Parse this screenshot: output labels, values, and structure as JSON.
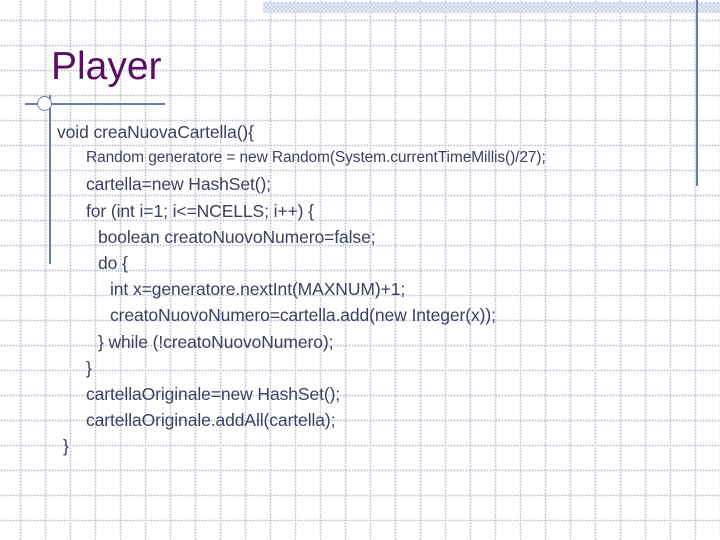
{
  "slide": {
    "title": "Player",
    "code": {
      "lines": [
        {
          "text": "void creaNuovaCartella(){",
          "indent": "a",
          "small": false
        },
        {
          "text": "Random generatore = new Random(System.currentTimeMillis()/27);",
          "indent": "b",
          "small": true
        },
        {
          "text": "cartella=new HashSet();",
          "indent": "b",
          "small": false
        },
        {
          "text": "for (int i=1; i<=NCELLS; i++) {",
          "indent": "b",
          "small": false
        },
        {
          "text": "boolean creatoNuovoNumero=false;",
          "indent": "c",
          "small": false
        },
        {
          "text": "do {",
          "indent": "c",
          "small": false
        },
        {
          "text": "int x=generatore.nextInt(MAXNUM)+1;",
          "indent": "d",
          "small": false
        },
        {
          "text": "creatoNuovoNumero=cartella.add(new Integer(x));",
          "indent": "d",
          "small": false
        },
        {
          "text": "} while (!creatoNuovoNumero);",
          "indent": "c",
          "small": false
        },
        {
          "text": "}",
          "indent": "b",
          "small": false
        },
        {
          "text": "cartellaOriginale=new HashSet();",
          "indent": "b",
          "small": false
        },
        {
          "text": "cartellaOriginale.addAll(cartella);",
          "indent": "b",
          "small": false
        },
        {
          "text": "}",
          "indent": "e",
          "small": false
        }
      ]
    }
  },
  "colors": {
    "title": "#5a0d62",
    "code_text": "#3d3f5f",
    "rule": "#6b7cab",
    "band": "#c7d4e9"
  }
}
